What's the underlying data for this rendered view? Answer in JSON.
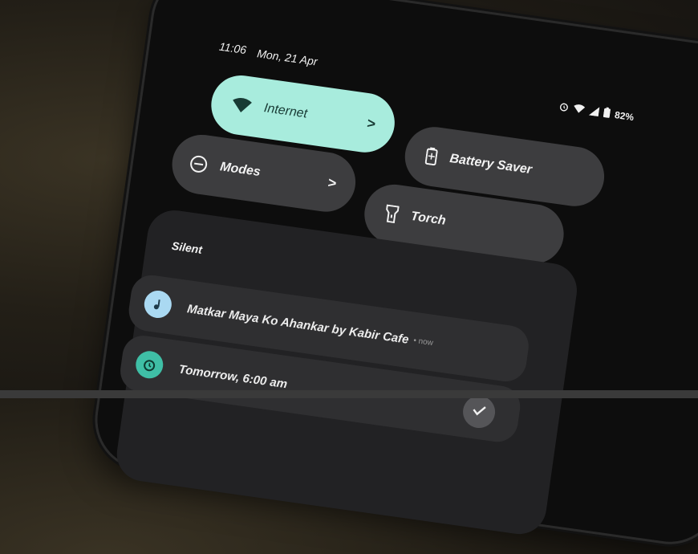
{
  "status_bar": {
    "time": "11:06",
    "date": "Mon, 21 Apr",
    "battery_percent": "82%",
    "icons": [
      "alarm-icon",
      "wifi-icon",
      "signal-icon",
      "battery-icon"
    ]
  },
  "quick_tiles": {
    "internet": {
      "label": "Internet",
      "chevron": ">",
      "icon": "wifi-icon",
      "active": true
    },
    "battery_saver": {
      "label": "Battery Saver",
      "icon": "battery-icon",
      "active": false
    },
    "modes": {
      "label": "Modes",
      "chevron": ">",
      "icon": "modes-icon",
      "active": false
    },
    "torch": {
      "label": "Torch",
      "icon": "flashlight-icon",
      "active": false
    }
  },
  "notifications": {
    "section_title": "Silent",
    "items": [
      {
        "text": "Matkar Maya Ko Ahankar by Kabir Cafe",
        "meta": "• now",
        "icon": "music-note-icon"
      },
      {
        "text": "Tomorrow, 6:00 am",
        "icon": "alarm-icon",
        "action_icon": "check-icon"
      }
    ]
  },
  "colors": {
    "accent_tile": "#a8ecdd",
    "tile_inactive": "#3d3d3f",
    "panel": "#222224",
    "music_icon_bg": "#aad9f2",
    "alarm_icon_bg": "#3fbfa6"
  }
}
